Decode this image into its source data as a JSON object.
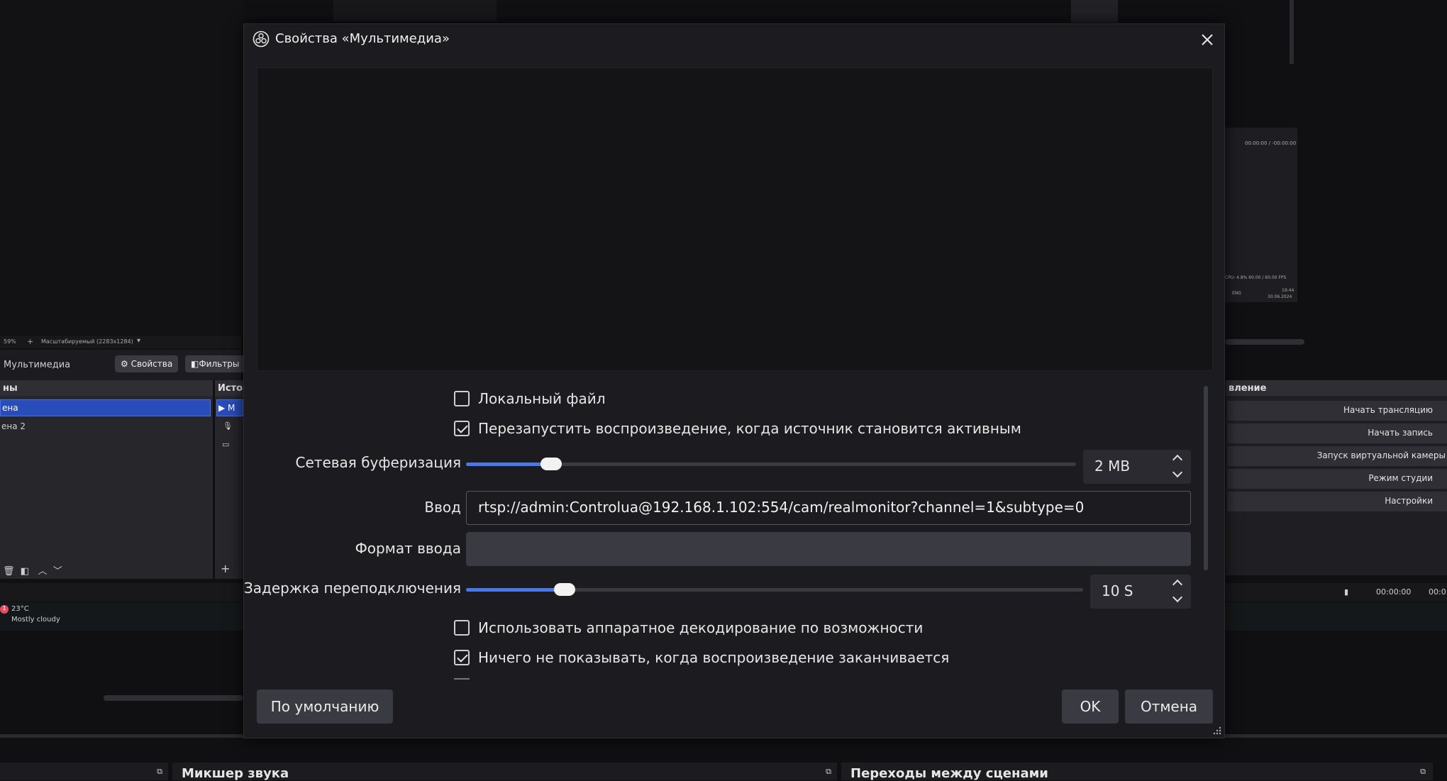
{
  "background": {
    "zoom_label": "59%",
    "scale_label": "Масштабируемый (2283x1284)",
    "source_name": "Мультимедиа",
    "properties_button": "Свойства",
    "filters_button": "Фильтры",
    "scenes_title": "ны",
    "sources_title": "Исто",
    "scenes": [
      "ена",
      "ена 2"
    ],
    "source_item_partial": "М",
    "controls_title": "вление",
    "controls": [
      "Начать трансляцию",
      "Начать запись",
      "Запуск виртуальной камеры",
      "Режим студии",
      "Настройки"
    ],
    "time_left": "00:00:00",
    "time_right": "00:0",
    "mini_time": "00:00:00 / -00:00:00",
    "mini_stats": "CPU: 4.8%   60.00 / 60.00 FPS",
    "weather_temp": "23°C",
    "weather_desc": "Mostly cloudy",
    "weather_badge": "1",
    "mixer_title": "Микшер звука",
    "transitions_title": "Переходы между сценами",
    "clock_time": "19:44",
    "clock_date": "30.06.2024",
    "lang": "ENG"
  },
  "dialog": {
    "title": "Свойства «Мультимедиа»",
    "checkboxes": [
      {
        "label": "Локальный файл",
        "checked": false
      },
      {
        "label": "Перезапустить воспроизведение, когда источник становится активным",
        "checked": true
      },
      {
        "label": "Использовать аппаратное декодирование по возможности",
        "checked": false
      },
      {
        "label": "Ничего не показывать, когда воспроизведение заканчивается",
        "checked": true
      }
    ],
    "network_buffering": {
      "label": "Сетевая буферизация",
      "value": "2 MB",
      "fraction": 0.14
    },
    "input": {
      "label": "Ввод",
      "value": "rtsp://admin:Controlua@192.168.1.102:554/cam/realmonitor?channel=1&subtype=0"
    },
    "input_format": {
      "label": "Формат ввода",
      "value": ""
    },
    "reconnect_delay": {
      "label": "Задержка переподключения",
      "value": "10 S",
      "fraction": 0.16
    },
    "defaults_button": "По умолчанию",
    "ok_button": "OK",
    "cancel_button": "Отмена"
  }
}
